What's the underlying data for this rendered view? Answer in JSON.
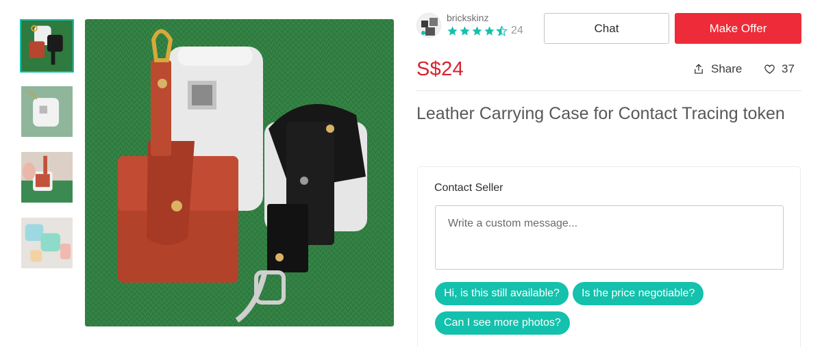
{
  "thumbnails": [
    {
      "label": "photo 1",
      "active": true
    },
    {
      "label": "photo 2",
      "active": false
    },
    {
      "label": "photo 3",
      "active": false
    },
    {
      "label": "photo 4",
      "active": false
    }
  ],
  "seller": {
    "name": "brickskinz",
    "rating": 4.5,
    "rating_count": "24"
  },
  "actions": {
    "chat_label": "Chat",
    "offer_label": "Make Offer"
  },
  "listing": {
    "price": "S$24",
    "share_label": "Share",
    "likes": "37",
    "title": "Leather Carrying Case for Contact Tracing token"
  },
  "contact": {
    "heading": "Contact Seller",
    "placeholder": "Write a custom message...",
    "quick_replies": [
      "Hi, is this still available?",
      "Is the price negotiable?",
      "Can I see more photos?"
    ]
  },
  "colors": {
    "accent": "#13c1ac",
    "price": "#d8222f",
    "offer_button": "#ee2b38",
    "star": "#13c1ac"
  }
}
